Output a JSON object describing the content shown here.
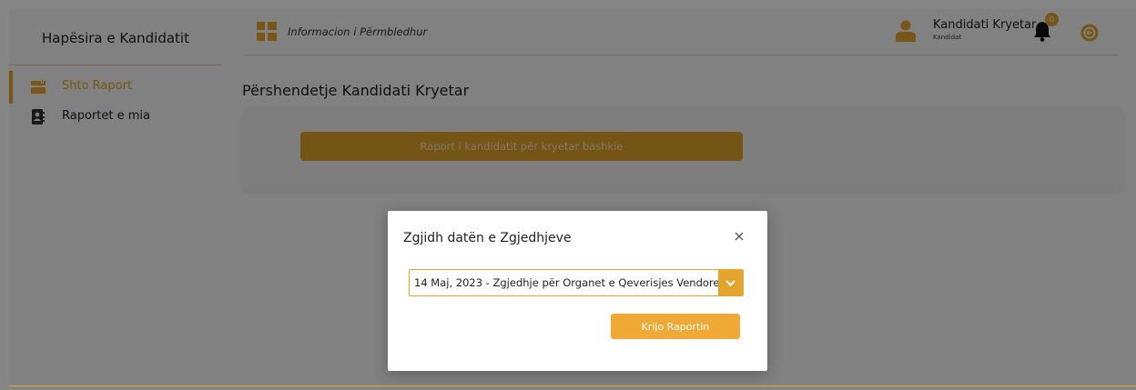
{
  "app": {
    "brand": "Hapësira e Kandidatit"
  },
  "sidebar": {
    "items": [
      {
        "label": "Shto Raport",
        "icon": "report-add-icon",
        "active": true
      },
      {
        "label": "Raportet e mia",
        "icon": "contacts-book-icon",
        "active": false
      }
    ]
  },
  "header": {
    "breadcrumb": "Informacion i Përmbledhur",
    "user": {
      "name": "Kandidati Kryetar",
      "role": "Kandidat"
    },
    "notifications": {
      "count": "0"
    }
  },
  "main": {
    "greeting": "Përshendetje Kandidati Kryetar",
    "report_button": "Raport i kandidatit për kryetar bashkie"
  },
  "modal": {
    "title": "Zgjidh datën e Zgjedhjeve",
    "select_value": "14 Maj, 2023 - Zgjedhje për Organet e Qeverisjes Vendore",
    "create_button": "Krijo Raportin"
  },
  "colors": {
    "accent": "#e4a52e",
    "background": "#f8f8f8",
    "overlay": "rgba(0,0,0,0.48)"
  }
}
